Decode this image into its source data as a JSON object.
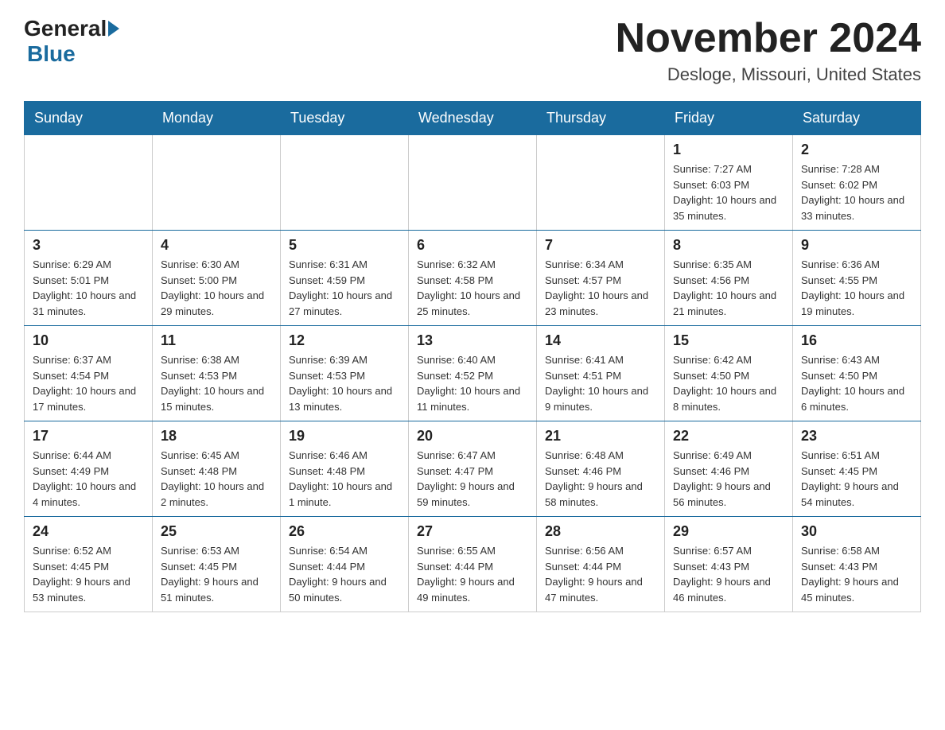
{
  "header": {
    "logo_general": "General",
    "logo_blue": "Blue",
    "month_title": "November 2024",
    "location": "Desloge, Missouri, United States"
  },
  "days_of_week": [
    "Sunday",
    "Monday",
    "Tuesday",
    "Wednesday",
    "Thursday",
    "Friday",
    "Saturday"
  ],
  "weeks": [
    [
      {
        "day": "",
        "info": ""
      },
      {
        "day": "",
        "info": ""
      },
      {
        "day": "",
        "info": ""
      },
      {
        "day": "",
        "info": ""
      },
      {
        "day": "",
        "info": ""
      },
      {
        "day": "1",
        "info": "Sunrise: 7:27 AM\nSunset: 6:03 PM\nDaylight: 10 hours and 35 minutes."
      },
      {
        "day": "2",
        "info": "Sunrise: 7:28 AM\nSunset: 6:02 PM\nDaylight: 10 hours and 33 minutes."
      }
    ],
    [
      {
        "day": "3",
        "info": "Sunrise: 6:29 AM\nSunset: 5:01 PM\nDaylight: 10 hours and 31 minutes."
      },
      {
        "day": "4",
        "info": "Sunrise: 6:30 AM\nSunset: 5:00 PM\nDaylight: 10 hours and 29 minutes."
      },
      {
        "day": "5",
        "info": "Sunrise: 6:31 AM\nSunset: 4:59 PM\nDaylight: 10 hours and 27 minutes."
      },
      {
        "day": "6",
        "info": "Sunrise: 6:32 AM\nSunset: 4:58 PM\nDaylight: 10 hours and 25 minutes."
      },
      {
        "day": "7",
        "info": "Sunrise: 6:34 AM\nSunset: 4:57 PM\nDaylight: 10 hours and 23 minutes."
      },
      {
        "day": "8",
        "info": "Sunrise: 6:35 AM\nSunset: 4:56 PM\nDaylight: 10 hours and 21 minutes."
      },
      {
        "day": "9",
        "info": "Sunrise: 6:36 AM\nSunset: 4:55 PM\nDaylight: 10 hours and 19 minutes."
      }
    ],
    [
      {
        "day": "10",
        "info": "Sunrise: 6:37 AM\nSunset: 4:54 PM\nDaylight: 10 hours and 17 minutes."
      },
      {
        "day": "11",
        "info": "Sunrise: 6:38 AM\nSunset: 4:53 PM\nDaylight: 10 hours and 15 minutes."
      },
      {
        "day": "12",
        "info": "Sunrise: 6:39 AM\nSunset: 4:53 PM\nDaylight: 10 hours and 13 minutes."
      },
      {
        "day": "13",
        "info": "Sunrise: 6:40 AM\nSunset: 4:52 PM\nDaylight: 10 hours and 11 minutes."
      },
      {
        "day": "14",
        "info": "Sunrise: 6:41 AM\nSunset: 4:51 PM\nDaylight: 10 hours and 9 minutes."
      },
      {
        "day": "15",
        "info": "Sunrise: 6:42 AM\nSunset: 4:50 PM\nDaylight: 10 hours and 8 minutes."
      },
      {
        "day": "16",
        "info": "Sunrise: 6:43 AM\nSunset: 4:50 PM\nDaylight: 10 hours and 6 minutes."
      }
    ],
    [
      {
        "day": "17",
        "info": "Sunrise: 6:44 AM\nSunset: 4:49 PM\nDaylight: 10 hours and 4 minutes."
      },
      {
        "day": "18",
        "info": "Sunrise: 6:45 AM\nSunset: 4:48 PM\nDaylight: 10 hours and 2 minutes."
      },
      {
        "day": "19",
        "info": "Sunrise: 6:46 AM\nSunset: 4:48 PM\nDaylight: 10 hours and 1 minute."
      },
      {
        "day": "20",
        "info": "Sunrise: 6:47 AM\nSunset: 4:47 PM\nDaylight: 9 hours and 59 minutes."
      },
      {
        "day": "21",
        "info": "Sunrise: 6:48 AM\nSunset: 4:46 PM\nDaylight: 9 hours and 58 minutes."
      },
      {
        "day": "22",
        "info": "Sunrise: 6:49 AM\nSunset: 4:46 PM\nDaylight: 9 hours and 56 minutes."
      },
      {
        "day": "23",
        "info": "Sunrise: 6:51 AM\nSunset: 4:45 PM\nDaylight: 9 hours and 54 minutes."
      }
    ],
    [
      {
        "day": "24",
        "info": "Sunrise: 6:52 AM\nSunset: 4:45 PM\nDaylight: 9 hours and 53 minutes."
      },
      {
        "day": "25",
        "info": "Sunrise: 6:53 AM\nSunset: 4:45 PM\nDaylight: 9 hours and 51 minutes."
      },
      {
        "day": "26",
        "info": "Sunrise: 6:54 AM\nSunset: 4:44 PM\nDaylight: 9 hours and 50 minutes."
      },
      {
        "day": "27",
        "info": "Sunrise: 6:55 AM\nSunset: 4:44 PM\nDaylight: 9 hours and 49 minutes."
      },
      {
        "day": "28",
        "info": "Sunrise: 6:56 AM\nSunset: 4:44 PM\nDaylight: 9 hours and 47 minutes."
      },
      {
        "day": "29",
        "info": "Sunrise: 6:57 AM\nSunset: 4:43 PM\nDaylight: 9 hours and 46 minutes."
      },
      {
        "day": "30",
        "info": "Sunrise: 6:58 AM\nSunset: 4:43 PM\nDaylight: 9 hours and 45 minutes."
      }
    ]
  ]
}
